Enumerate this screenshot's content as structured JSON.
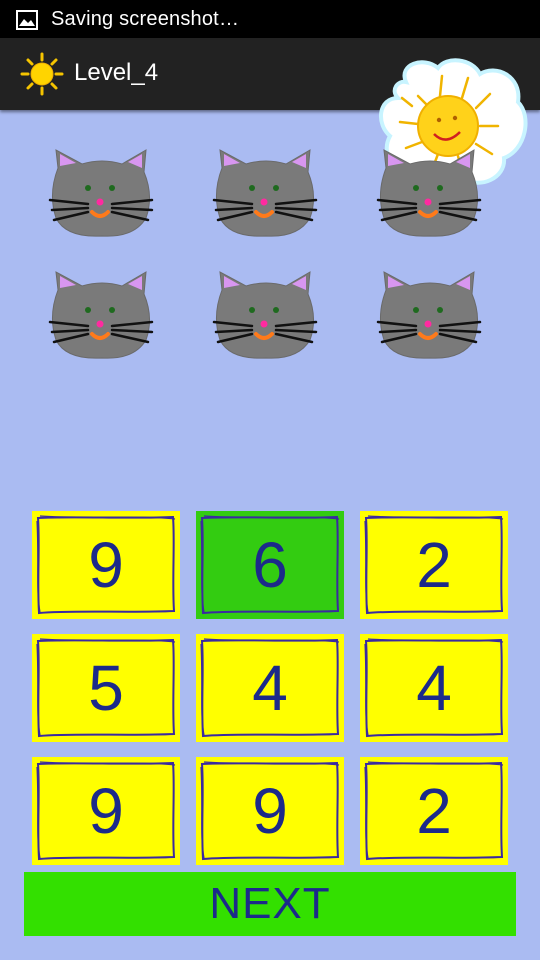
{
  "status_bar": {
    "notification_icon": "image-icon",
    "text": "Saving screenshot…"
  },
  "action_bar": {
    "app_icon": "sun-icon",
    "title": "Level_4"
  },
  "decoration": {
    "icon": "smiling-sun-icon"
  },
  "cats": {
    "count": 6,
    "icon": "cat-face-icon"
  },
  "answers": [
    {
      "label": "9",
      "selected": false
    },
    {
      "label": "6",
      "selected": true
    },
    {
      "label": "2",
      "selected": false
    },
    {
      "label": "5",
      "selected": false
    },
    {
      "label": "4",
      "selected": false
    },
    {
      "label": "4",
      "selected": false
    },
    {
      "label": "9",
      "selected": false
    },
    {
      "label": "9",
      "selected": false
    },
    {
      "label": "2",
      "selected": false
    }
  ],
  "next_button": {
    "label": "NEXT"
  },
  "colors": {
    "background": "#aabbf2",
    "tile": "#ffff00",
    "tile_selected": "#33cc11",
    "next_button": "#33e000",
    "digit": "#1c2a8a"
  }
}
